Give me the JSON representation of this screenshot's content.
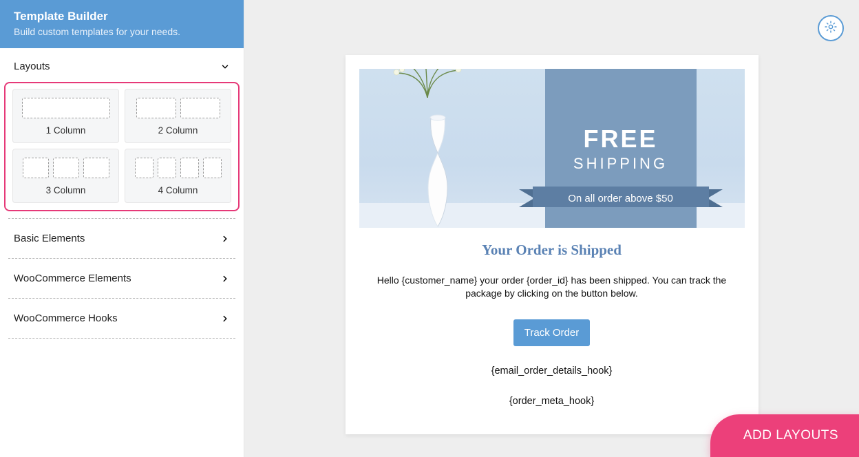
{
  "sidebar": {
    "title": "Template Builder",
    "subtitle": "Build custom templates for your needs.",
    "layouts_section_label": "Layouts",
    "layout_cards": [
      {
        "label": "1 Column"
      },
      {
        "label": "2 Column"
      },
      {
        "label": "3 Column"
      },
      {
        "label": "4 Column"
      }
    ],
    "collapsed_sections": [
      {
        "label": "Basic Elements"
      },
      {
        "label": "WooCommerce Elements"
      },
      {
        "label": "WooCommerce Hooks"
      }
    ]
  },
  "hero": {
    "line1": "FREE",
    "line2": "SHIPPING",
    "ribbon": "On all order above $50"
  },
  "preview": {
    "title": "Your Order is Shipped",
    "description": "Hello {customer_name} your order {order_id} has been shipped. You can track the package by clicking on the button below.",
    "track_button": "Track Order",
    "hook1": "{email_order_details_hook}",
    "hook2": "{order_meta_hook}"
  },
  "footer_button": "ADD LAYOUTS"
}
